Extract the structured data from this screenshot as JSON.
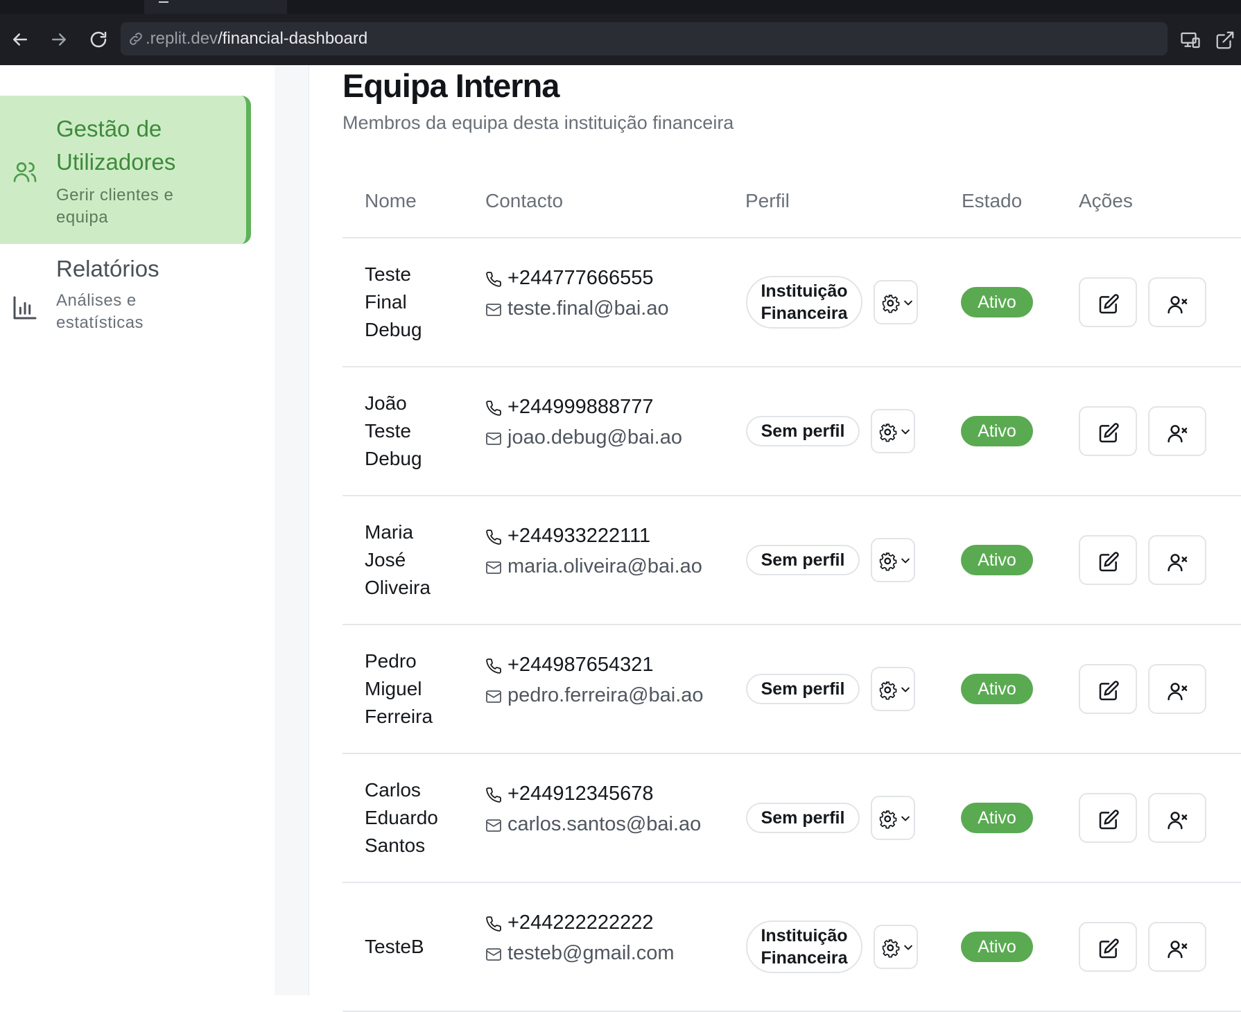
{
  "browser": {
    "url_host": ".replit.dev",
    "url_path": "/financial-dashboard"
  },
  "sidebar": {
    "items": [
      {
        "title": "Gestão de Utilizadores",
        "description": "Gerir clientes e equipa",
        "icon": "users-icon",
        "active": true
      },
      {
        "title": "Relatórios",
        "description": "Análises e estatísticas",
        "icon": "bar-chart-icon",
        "active": false
      }
    ]
  },
  "main": {
    "title": "Equipa Interna",
    "subtitle": "Membros da equipa desta instituição financeira",
    "table": {
      "headers": {
        "name": "Nome",
        "contact": "Contacto",
        "profile": "Perfil",
        "status": "Estado",
        "actions": "Ações"
      },
      "rows": [
        {
          "name_lines": [
            "Teste",
            "Final",
            "Debug"
          ],
          "phone": "+244777666555",
          "email": "teste.final@bai.ao",
          "profile_lines": [
            "Instituição",
            "Financeira"
          ],
          "status": "Ativo"
        },
        {
          "name_lines": [
            "João",
            "Teste",
            "Debug"
          ],
          "phone": "+244999888777",
          "email": "joao.debug@bai.ao",
          "profile_lines": [
            "Sem perfil"
          ],
          "status": "Ativo"
        },
        {
          "name_lines": [
            "Maria",
            "José",
            "Oliveira"
          ],
          "phone": "+244933222111",
          "email": "maria.oliveira@bai.ao",
          "profile_lines": [
            "Sem perfil"
          ],
          "status": "Ativo"
        },
        {
          "name_lines": [
            "Pedro",
            "Miguel",
            "Ferreira"
          ],
          "phone": "+244987654321",
          "email": "pedro.ferreira@bai.ao",
          "profile_lines": [
            "Sem perfil"
          ],
          "status": "Ativo"
        },
        {
          "name_lines": [
            "Carlos",
            "Eduardo",
            "Santos"
          ],
          "phone": "+244912345678",
          "email": "carlos.santos@bai.ao",
          "profile_lines": [
            "Sem perfil"
          ],
          "status": "Ativo"
        },
        {
          "name_lines": [
            "TesteB"
          ],
          "phone": "+244222222222",
          "email": "testeb@gmail.com",
          "profile_lines": [
            "Instituição",
            "Financeira"
          ],
          "status": "Ativo"
        }
      ]
    }
  },
  "colors": {
    "accent": "#5fb25a",
    "active_bg": "#cdecc6",
    "status_active": "#5aaa52"
  }
}
